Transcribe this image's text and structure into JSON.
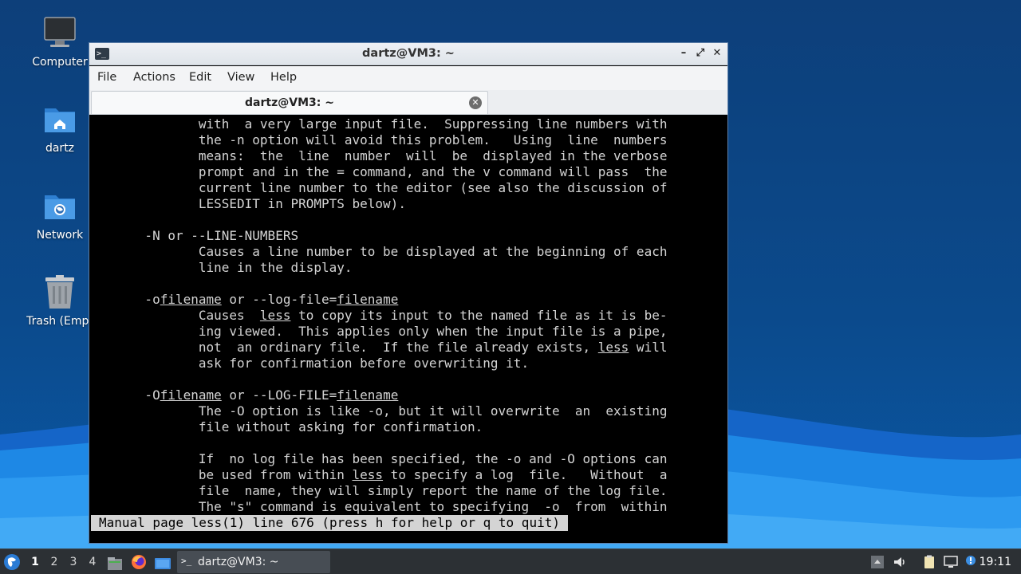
{
  "desktop": {
    "icons": [
      {
        "label": "Computer",
        "icon": "monitor-icon"
      },
      {
        "label": "dartz",
        "icon": "home-folder-icon"
      },
      {
        "label": "Network",
        "icon": "network-folder-icon"
      },
      {
        "label": "Trash (Empt",
        "icon": "trash-icon"
      }
    ]
  },
  "window": {
    "title": "dartz@VM3: ~",
    "menu": [
      "File",
      "Actions",
      "Edit",
      "View",
      "Help"
    ],
    "tab_label": "dartz@VM3: ~",
    "controls": {
      "minimize": "–",
      "maximize": "⤢",
      "close": "✕"
    }
  },
  "terminal": {
    "lines": [
      "              with  a very large input file.  Suppressing line numbers with",
      "              the -n option will avoid this problem.   Using  line  numbers",
      "              means:  the  line  number  will  be  displayed in the verbose",
      "              prompt and in the = command, and the v command will pass  the",
      "              current line number to the editor (see also the discussion of",
      "              LESSEDIT in PROMPTS below).",
      "",
      "       -N or --LINE-NUMBERS",
      "              Causes a line number to be displayed at the beginning of each",
      "              line in the display.",
      "",
      "       -ofilename or --log-file=filename",
      "              Causes  less to copy its input to the named file as it is be‐",
      "              ing viewed.  This applies only when the input file is a pipe,",
      "              not  an ordinary file.  If the file already exists, less will",
      "              ask for confirmation before overwriting it.",
      "",
      "       -Ofilename or --LOG-FILE=filename",
      "              The -O option is like -o, but it will overwrite  an  existing",
      "              file without asking for confirmation.",
      "",
      "              If  no log file has been specified, the -o and -O options can",
      "              be used from within less to specify a log  file.   Without  a",
      "              file  name, they will simply report the name of the log file.",
      "              The \"s\" command is equivalent to specifying  -o  from  within"
    ],
    "status": "Manual page less(1) line 676 (press h for help or q to quit)"
  },
  "taskbar": {
    "workspaces": [
      "1",
      "2",
      "3",
      "4"
    ],
    "active_workspace": "1",
    "task_label": "dartz@VM3: ~",
    "clock": "19:11"
  }
}
